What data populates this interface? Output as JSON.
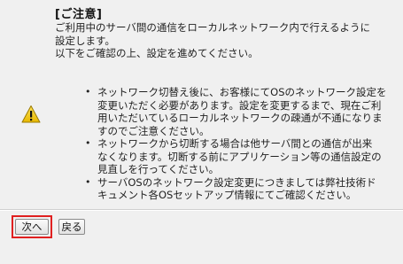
{
  "notice": {
    "title": "[ご注意]",
    "intro_lines": [
      "ご利用中のサーバ間の通信をローカルネットワーク内で行えるように",
      "設定します。",
      "以下をご確認の上、設定を進めてください。"
    ],
    "icon": "warning-icon",
    "bullets": [
      {
        "lines": [
          "ネットワーク切替え後に、お客様にてOSのネットワーク設定を",
          "変更いただく必要があります。設定を変更するまで、現在ご利",
          "用いただいているローカルネットワークの疎通が不通になりま",
          "すのでご注意ください。"
        ]
      },
      {
        "lines": [
          "ネットワークから切断する場合は他サーバ間との通信が出来",
          "なくなります。切断する前にアプリケーション等の通信設定の",
          "見直しを行ってください。"
        ]
      },
      {
        "lines": [
          "サーバOSのネットワーク設定変更につきましては弊社技術ド",
          "キュメント各OSセットアップ情報にてご確認ください。"
        ]
      }
    ]
  },
  "buttons": {
    "next_label": "次へ",
    "back_label": "戻る"
  },
  "colors": {
    "highlight": "#e02020",
    "warning": "#f5c800"
  }
}
